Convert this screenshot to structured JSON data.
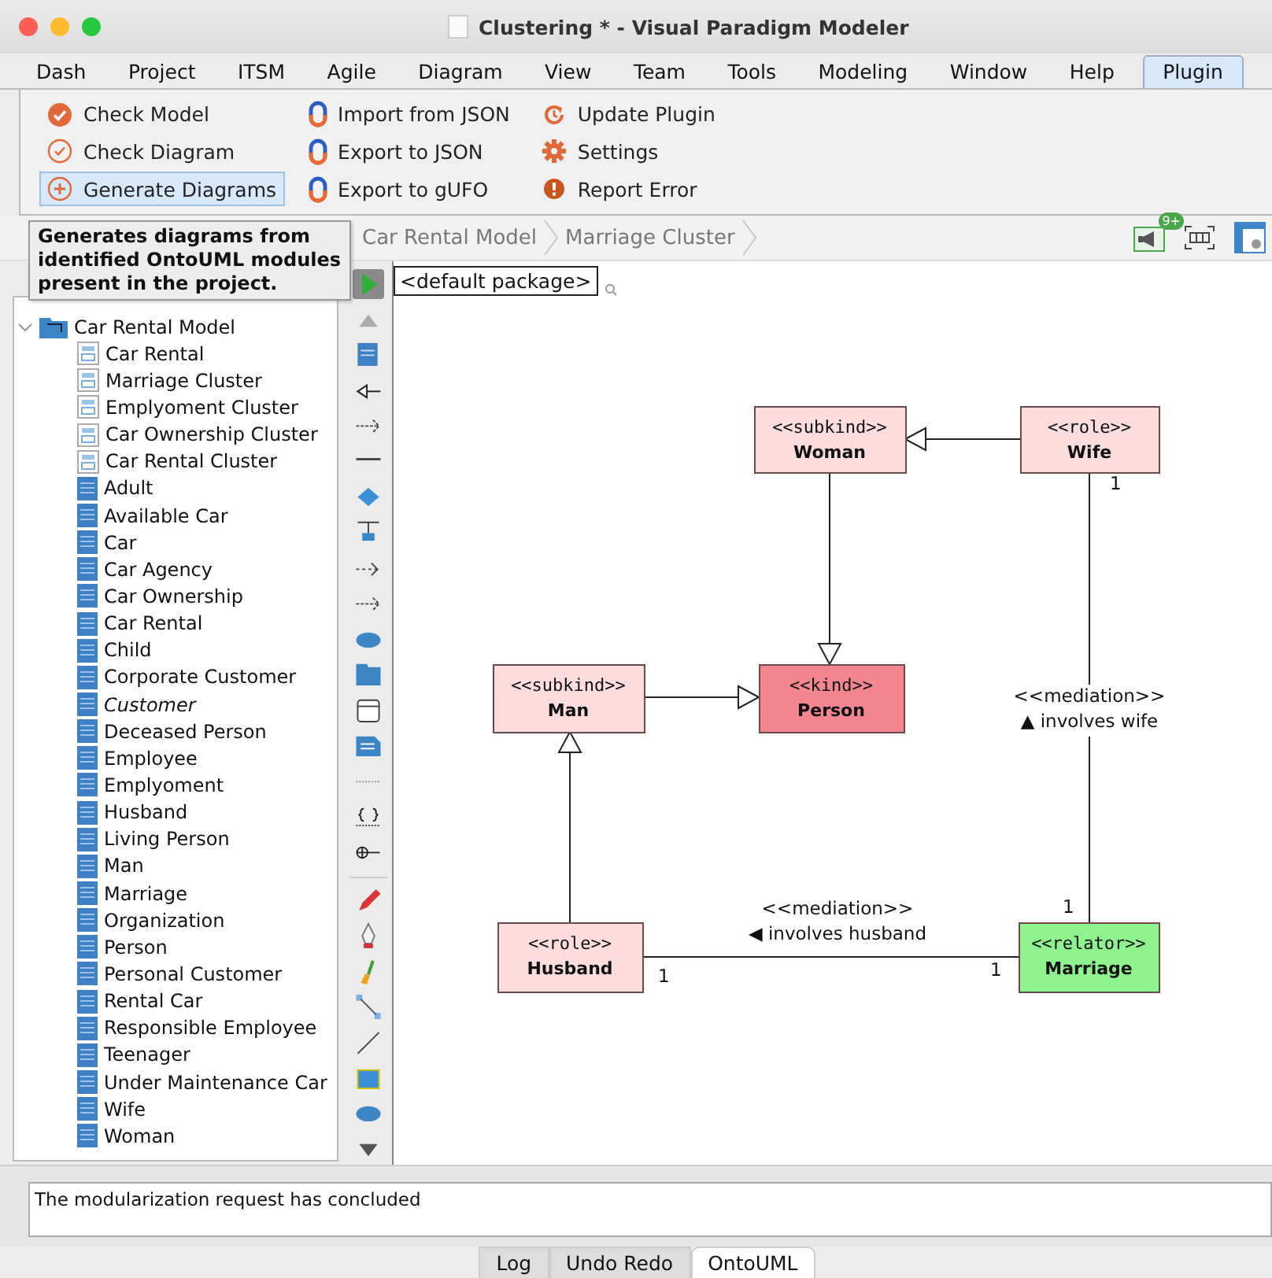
{
  "window": {
    "title": "Clustering * - Visual Paradigm Modeler"
  },
  "menu": [
    {
      "label": "Dash",
      "selected": false
    },
    {
      "label": "Project",
      "selected": false
    },
    {
      "label": "ITSM",
      "selected": false
    },
    {
      "label": "Agile",
      "selected": false
    },
    {
      "label": "Diagram",
      "selected": false
    },
    {
      "label": "View",
      "selected": false
    },
    {
      "label": "Team",
      "selected": false
    },
    {
      "label": "Tools",
      "selected": false
    },
    {
      "label": "Modeling",
      "selected": false
    },
    {
      "label": "Window",
      "selected": false
    },
    {
      "label": "Help",
      "selected": false
    },
    {
      "label": "Plugin",
      "selected": true
    }
  ],
  "ribbon": [
    [
      {
        "label": "Check Model",
        "kind": "check-filled",
        "selected": false
      },
      {
        "label": "Check Diagram",
        "kind": "check-outline",
        "selected": false
      },
      {
        "label": "Generate Diagrams",
        "kind": "plus",
        "selected": true
      }
    ],
    [
      {
        "label": "Import from JSON",
        "kind": "json",
        "selected": false
      },
      {
        "label": "Export to JSON",
        "kind": "json",
        "selected": false
      },
      {
        "label": "Export to gUFO",
        "kind": "json",
        "selected": false
      }
    ],
    [
      {
        "label": "Update Plugin",
        "kind": "update",
        "selected": false
      },
      {
        "label": "Settings",
        "kind": "gear",
        "selected": false
      },
      {
        "label": "Report Error",
        "kind": "error",
        "selected": false
      }
    ]
  ],
  "tooltip": {
    "text": "Generates diagrams from identified OntoUML modules present in the project."
  },
  "breadcrumbs": [
    "Car Rental Model",
    "Marriage Cluster"
  ],
  "notification_badge": "9+",
  "package_field": {
    "value": "<default package>"
  },
  "tree": {
    "label": "Car Rental Model",
    "expanded": true,
    "children": [
      {
        "label": "Car Rental",
        "kind": "diagram",
        "italic": false
      },
      {
        "label": "Marriage Cluster",
        "kind": "diagram",
        "italic": false
      },
      {
        "label": "Emplyoment Cluster",
        "kind": "diagram",
        "italic": false
      },
      {
        "label": "Car Ownership Cluster",
        "kind": "diagram",
        "italic": false
      },
      {
        "label": "Car Rental Cluster",
        "kind": "diagram",
        "italic": false
      },
      {
        "label": "Adult",
        "kind": "class",
        "italic": false
      },
      {
        "label": "Available Car",
        "kind": "class",
        "italic": false
      },
      {
        "label": "Car",
        "kind": "class",
        "italic": false
      },
      {
        "label": "Car Agency",
        "kind": "class",
        "italic": false
      },
      {
        "label": "Car Ownership",
        "kind": "class",
        "italic": false
      },
      {
        "label": "Car Rental",
        "kind": "class",
        "italic": false
      },
      {
        "label": "Child",
        "kind": "class",
        "italic": false
      },
      {
        "label": "Corporate Customer",
        "kind": "class",
        "italic": false
      },
      {
        "label": "Customer",
        "kind": "class",
        "italic": true
      },
      {
        "label": "Deceased Person",
        "kind": "class",
        "italic": false
      },
      {
        "label": "Employee",
        "kind": "class",
        "italic": false
      },
      {
        "label": "Emplyoment",
        "kind": "class",
        "italic": false
      },
      {
        "label": "Husband",
        "kind": "class",
        "italic": false
      },
      {
        "label": "Living Person",
        "kind": "class",
        "italic": false
      },
      {
        "label": "Man",
        "kind": "class",
        "italic": false
      },
      {
        "label": "Marriage",
        "kind": "class",
        "italic": false
      },
      {
        "label": "Organization",
        "kind": "class",
        "italic": false
      },
      {
        "label": "Person",
        "kind": "class",
        "italic": false
      },
      {
        "label": "Personal Customer",
        "kind": "class",
        "italic": false
      },
      {
        "label": "Rental Car",
        "kind": "class",
        "italic": false
      },
      {
        "label": "Responsible Employee",
        "kind": "class",
        "italic": false
      },
      {
        "label": "Teenager",
        "kind": "class",
        "italic": false
      },
      {
        "label": "Under Maintenance Car",
        "kind": "class",
        "italic": false
      },
      {
        "label": "Wife",
        "kind": "class",
        "italic": false
      },
      {
        "label": "Woman",
        "kind": "class",
        "italic": false
      }
    ]
  },
  "diagram": {
    "nodes": [
      {
        "stereotype": "<<subkind>>",
        "name": "Woman",
        "color": "#fcdcdc"
      },
      {
        "stereotype": "<<role>>",
        "name": "Wife",
        "color": "#fcdcdc"
      },
      {
        "stereotype": "<<subkind>>",
        "name": "Man",
        "color": "#fcdcdc"
      },
      {
        "stereotype": "<<kind>>",
        "name": "Person",
        "color": "#f4868f"
      },
      {
        "stereotype": "<<role>>",
        "name": "Husband",
        "color": "#fcdcdc"
      },
      {
        "stereotype": "<<relator>>",
        "name": "Marriage",
        "color": "#8ef28e"
      }
    ],
    "edges": [
      {
        "kind": "generalization"
      },
      {
        "kind": "generalization"
      },
      {
        "kind": "generalization"
      },
      {
        "kind": "generalization"
      },
      {
        "kind": "mediation",
        "stereotype": "<<mediation>>",
        "label": "▲ involves wife",
        "source_multiplicity": "1",
        "target_multiplicity": "1"
      },
      {
        "kind": "mediation",
        "stereotype": "<<mediation>>",
        "label": "◀ involves husband",
        "source_multiplicity": "1",
        "target_multiplicity": "1"
      }
    ]
  },
  "message": "The modularization request has concluded",
  "bottom_tabs": [
    {
      "label": "Log",
      "selected": false
    },
    {
      "label": "Undo Redo",
      "selected": false
    },
    {
      "label": "OntoUML",
      "selected": true
    }
  ]
}
